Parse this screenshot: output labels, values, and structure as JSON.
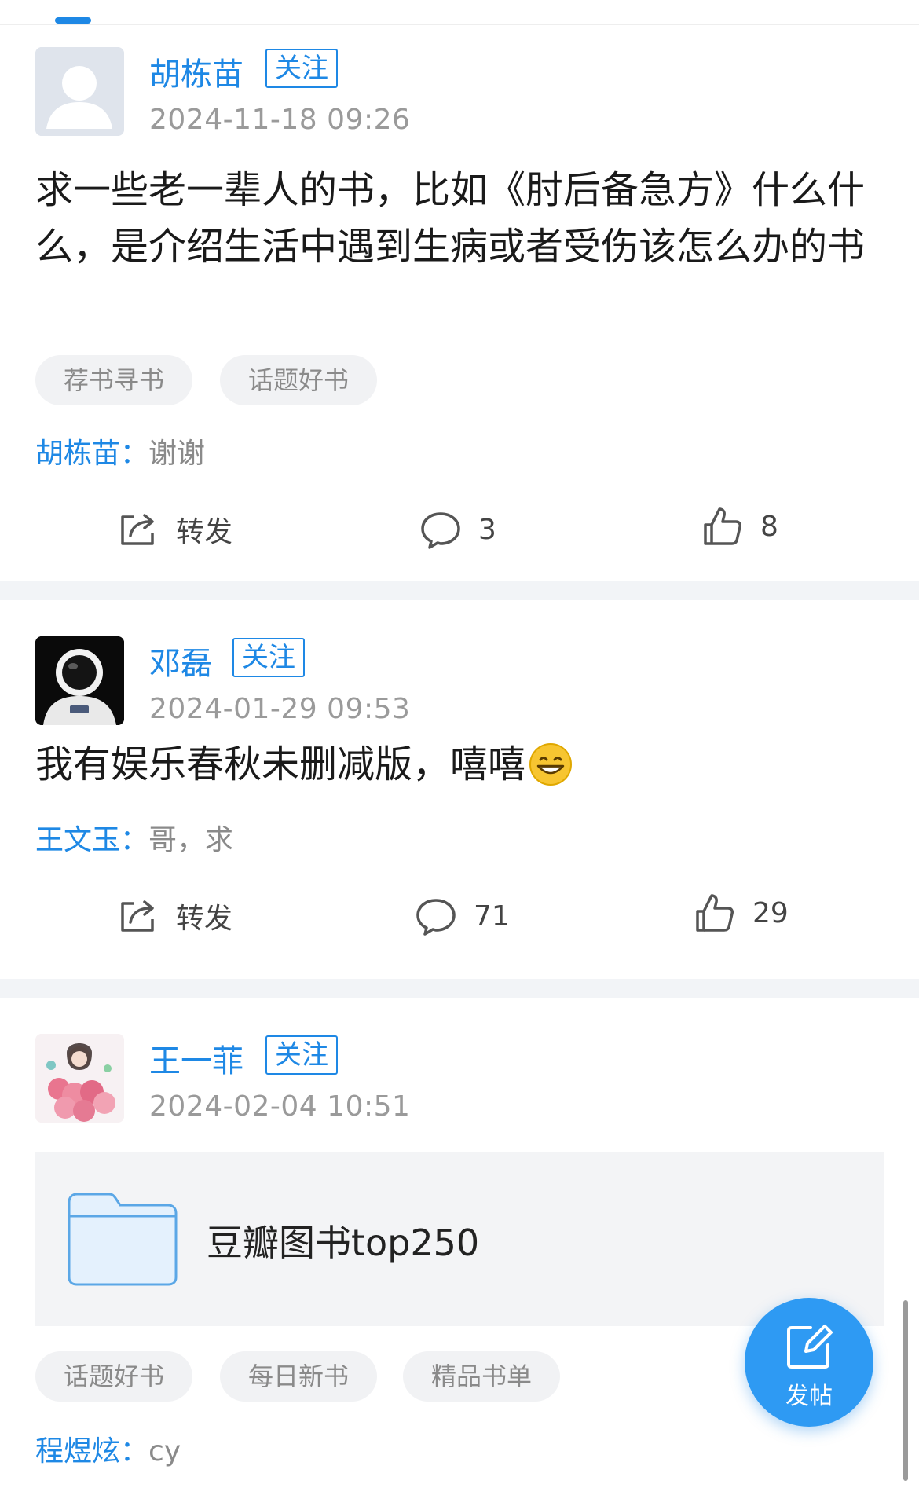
{
  "posts": [
    {
      "username": "胡栋苗",
      "follow_label": "关注",
      "timestamp": "2024-11-18 09:26",
      "content": "求一些老一辈人的书，比如《肘后备急方》什么什么，是介绍生活中遇到生病或者受伤该怎么办的书",
      "tags": [
        "荐书寻书",
        "话题好书"
      ],
      "comment": {
        "author": "胡栋苗",
        "separator": "：",
        "text": "谢谢"
      },
      "actions": {
        "share_label": "转发",
        "comment_count": "3",
        "like_count": "8"
      }
    },
    {
      "username": "邓磊",
      "follow_label": "关注",
      "timestamp": "2024-01-29 09:53",
      "content": "我有娱乐春秋未删减版，嘻嘻",
      "comment": {
        "author": "王文玉",
        "separator": "：",
        "text": "哥，求"
      },
      "actions": {
        "share_label": "转发",
        "comment_count": "71",
        "like_count": "29"
      }
    },
    {
      "username": "王一菲",
      "follow_label": "关注",
      "timestamp": "2024-02-04 10:51",
      "folder": {
        "name": "豆瓣图书top250",
        "icon": "folder-icon"
      },
      "tags": [
        "话题好书",
        "每日新书",
        "精品书单"
      ],
      "comment": {
        "author": "程煜炫",
        "separator": "：",
        "text": "cy"
      }
    }
  ],
  "fab": {
    "label": "发帖",
    "icon": "edit-icon"
  },
  "colors": {
    "accent": "#1e88e5",
    "tag_bg": "#f1f2f4",
    "muted": "#9a9a9a"
  }
}
